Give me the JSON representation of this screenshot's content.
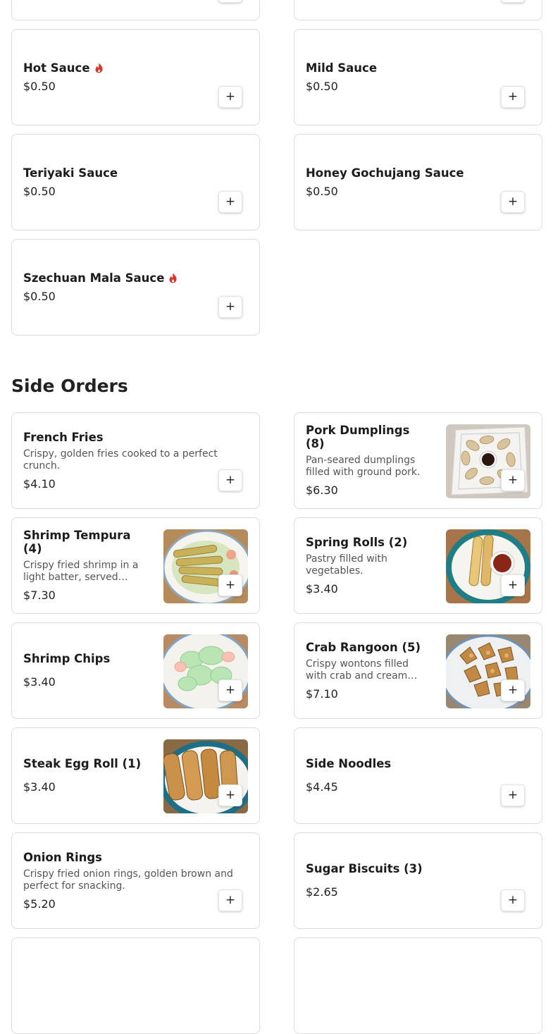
{
  "colors": {
    "chili": "#d9362c",
    "border": "#dcdcdc",
    "text": "#1c1c1c"
  },
  "sauces": [
    {
      "name": "Hot Sauce",
      "price": "$0.50",
      "spicy": true
    },
    {
      "name": "Mild Sauce",
      "price": "$0.50",
      "spicy": false
    },
    {
      "name": "Teriyaki Sauce",
      "price": "$0.50",
      "spicy": false
    },
    {
      "name": "Honey Gochujang Sauce",
      "price": "$0.50",
      "spicy": false
    },
    {
      "name": "Szechuan Mala Sauce",
      "price": "$0.50",
      "spicy": true
    }
  ],
  "side_orders": {
    "title": "Side Orders",
    "items": [
      {
        "name": "French Fries",
        "desc": "Crispy, golden fries cooked to a perfect crunch.",
        "price": "$4.10"
      },
      {
        "name": "Pork Dumplings (8)",
        "desc": "Pan-seared dumplings filled with ground pork.",
        "price": "$6.30",
        "image": "dumplings"
      },
      {
        "name": "Shrimp Tempura (4)",
        "desc": "Crispy fried shrimp in a light batter, served…",
        "price": "$7.30",
        "image": "tempura"
      },
      {
        "name": "Spring Rolls (2)",
        "desc": "Pastry filled with vegetables.",
        "price": "$3.40",
        "image": "spring-rolls"
      },
      {
        "name": "Shrimp Chips",
        "price": "$3.40",
        "image": "shrimp-chips"
      },
      {
        "name": "Crab Rangoon (5)",
        "desc": "Crispy wontons filled with crab and cream…",
        "price": "$7.10",
        "image": "crab-rangoon"
      },
      {
        "name": "Steak Egg Roll (1)",
        "price": "$3.40",
        "image": "egg-roll"
      },
      {
        "name": "Side Noodles",
        "price": "$4.45"
      },
      {
        "name": "Onion Rings",
        "desc": "Crispy fried onion rings, golden brown and perfect for snacking.",
        "price": "$5.20"
      },
      {
        "name": "Sugar Biscuits (3)",
        "price": "$2.65"
      }
    ]
  },
  "add_button": {
    "icon": "plus-icon",
    "label": "+"
  }
}
